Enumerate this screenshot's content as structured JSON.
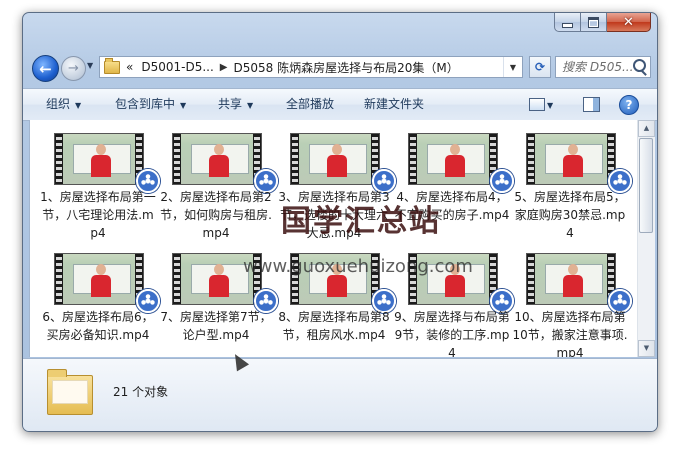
{
  "window": {
    "address": {
      "overflow": "«",
      "crumbs": [
        "D5001-D5...",
        "D5058 陈炳森房屋选择与布局20集（M）"
      ]
    },
    "search": {
      "placeholder": "搜索 D505..."
    }
  },
  "toolbar": {
    "organize": "组织",
    "include_library": "包含到库中",
    "share": "共享",
    "play_all": "全部播放",
    "new_folder": "新建文件夹"
  },
  "files": [
    {
      "name": "1、房屋选择布局第一节，八宅理论用法.mp4"
    },
    {
      "name": "2、房屋选择布局第2节，如何购房与租房.mp4"
    },
    {
      "name": "3、房屋选择布局第3节，选楼的十大理六大忌.mp4"
    },
    {
      "name": "4、房屋选择布局4，不宜购买的房子.mp4"
    },
    {
      "name": "5、房屋选择布局5，家庭购房30禁忌.mp4"
    },
    {
      "name": "6、房屋选择布局6，买房必备知识.mp4"
    },
    {
      "name": "7、房屋选择第7节，论户型.mp4"
    },
    {
      "name": "8、房屋选择布局第8节，租房风水.mp4"
    },
    {
      "name": "9、房屋选择与布局第9节，装修的工序.mp4"
    },
    {
      "name": "10、房屋选择布局第10节，搬家注意事项.mp4"
    }
  ],
  "watermark": {
    "text": "国学汇总站",
    "url": "www.guoxuehuizong.com"
  },
  "details": {
    "count": "21 个对象"
  }
}
